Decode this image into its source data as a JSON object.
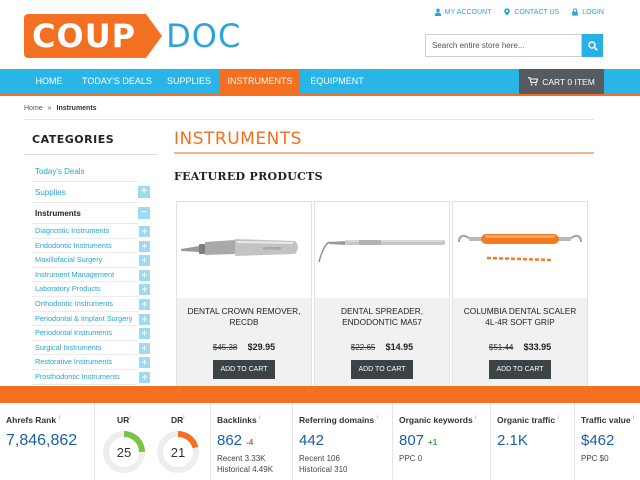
{
  "logo": {
    "part1": "COUP",
    "part2": "DOC"
  },
  "toplinks": [
    {
      "label": "MY ACCOUNT",
      "icon": "user-icon"
    },
    {
      "label": "CONTACT US",
      "icon": "map-pin-icon"
    },
    {
      "label": "LOGIN",
      "icon": "lock-icon"
    }
  ],
  "search": {
    "placeholder": "Search entire store here...",
    "value": ""
  },
  "nav": {
    "items": [
      "HOME",
      "TODAY'S DEALS",
      "SUPPLIES",
      "INSTRUMENTS",
      "EQUIPMENT"
    ],
    "active": "INSTRUMENTS",
    "cart_label": "CART 0 ITEM"
  },
  "breadcrumb": {
    "home": "Home",
    "separator": "»",
    "current": "Instruments"
  },
  "sidebar": {
    "title": "CATEGORIES",
    "items": [
      {
        "label": "Today's Deals",
        "toggle": ""
      },
      {
        "label": "Supplies",
        "toggle": "+"
      },
      {
        "label": "Instruments",
        "toggle": "−"
      }
    ],
    "subitems": [
      "Diagnostic Instruments",
      "Endodontic Instruments",
      "Maxillofacial Surgery",
      "Instrument Management",
      "Laboratory Products",
      "Orthodontic Instruments",
      "Periodontal & Implant Surgery",
      "Periodontal Instruments",
      "Surgical Instruments",
      "Restorative Instruments",
      "Prosthodontic Instruments"
    ],
    "subitem_toggle": "+"
  },
  "main": {
    "title": "INSTRUMENTS",
    "featured": "FEATURED PRODUCTS",
    "products": [
      {
        "name": "DENTAL CROWN REMOVER, RECDB",
        "old_price": "$45.38",
        "price": "$29.95",
        "button": "ADD TO CART"
      },
      {
        "name": "DENTAL SPREADER, ENDODONTIC MA57",
        "old_price": "$22.65",
        "price": "$14.95",
        "button": "ADD TO CART"
      },
      {
        "name": "COLUMBIA DENTAL SCALER 4L-4R SOFT GRIP",
        "old_price": "$51.44",
        "price": "$33.95",
        "button": "ADD TO CART"
      }
    ]
  },
  "ahrefs": {
    "rank": {
      "label": "Ahrefs Rank",
      "value": "7,846,862"
    },
    "ur": {
      "label": "UR",
      "value": "25",
      "percent": 25,
      "color": "#7dc242"
    },
    "dr": {
      "label": "DR",
      "value": "21",
      "percent": 21,
      "color": "#f36f21"
    },
    "backlinks": {
      "label": "Backlinks",
      "value": "862",
      "delta": "-4",
      "recent": "Recent 3.33K",
      "historical": "Historical 4.49K"
    },
    "referring": {
      "label": "Referring domains",
      "value": "442",
      "recent": "Recent 106",
      "historical": "Historical 310"
    },
    "keywords": {
      "label": "Organic keywords",
      "value": "807",
      "delta": "+1",
      "ppc": "PPC 0"
    },
    "traffic": {
      "label": "Organic traffic",
      "value": "2.1K"
    },
    "traffic_value": {
      "label": "Traffic value",
      "value": "$462",
      "ppc": "PPC $0"
    },
    "info_mark": "i"
  }
}
